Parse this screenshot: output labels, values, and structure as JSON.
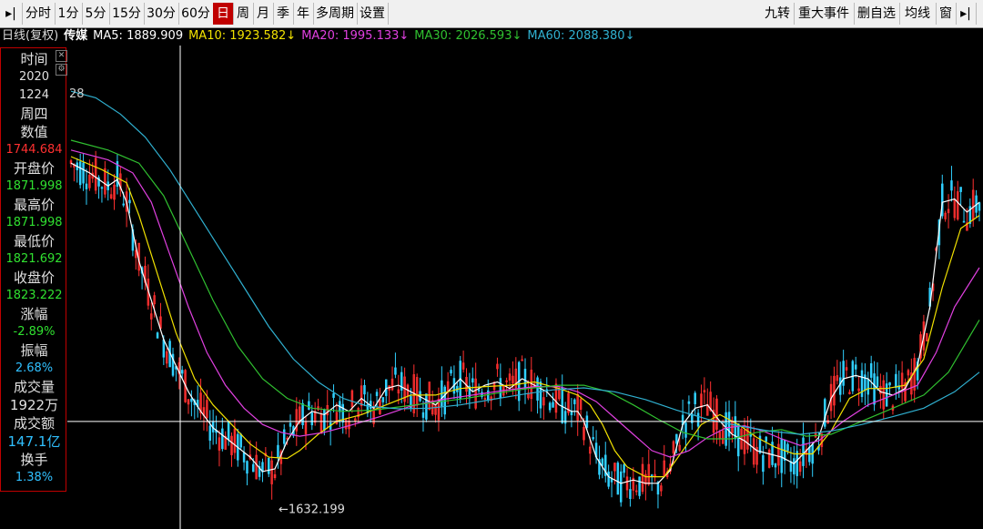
{
  "toolbar": {
    "left_buttons": [
      {
        "label": "▸|",
        "active": false
      },
      {
        "label": "分时",
        "active": false
      },
      {
        "label": "1分",
        "active": false
      },
      {
        "label": "5分",
        "active": false
      },
      {
        "label": "15分",
        "active": false
      },
      {
        "label": "30分",
        "active": false
      },
      {
        "label": "60分",
        "active": false
      },
      {
        "label": "日",
        "active": true
      },
      {
        "label": "周",
        "active": false
      },
      {
        "label": "月",
        "active": false
      },
      {
        "label": "季",
        "active": false
      },
      {
        "label": "年",
        "active": false
      },
      {
        "label": "多周期",
        "active": false
      },
      {
        "label": "设置",
        "active": false
      }
    ],
    "right_buttons": [
      {
        "label": "九转"
      },
      {
        "label": "重大事件"
      },
      {
        "label": "删自选"
      },
      {
        "label": "均线"
      },
      {
        "label": "窗"
      },
      {
        "label": "▸|"
      }
    ]
  },
  "legend": {
    "prefix": "日线(复权)",
    "name": "传媒",
    "items": [
      {
        "label": "MA5: 1889.909",
        "color": "#ffffff"
      },
      {
        "label": "MA10: 1923.582↓",
        "color": "#f0e000"
      },
      {
        "label": "MA20: 1995.133↓",
        "color": "#e040e0"
      },
      {
        "label": "MA30: 2026.593↓",
        "color": "#30c030"
      },
      {
        "label": "MA60: 2088.380↓",
        "color": "#30b0d0"
      }
    ]
  },
  "info_panel": [
    {
      "text": "时间",
      "color": "#e0e0e0",
      "small": false
    },
    {
      "text": "2020",
      "color": "#e0e0e0",
      "small": true
    },
    {
      "text": "1224",
      "color": "#e0e0e0",
      "small": true
    },
    {
      "text": "周四",
      "color": "#e0e0e0",
      "small": false
    },
    {
      "text": "数值",
      "color": "#e0e0e0",
      "small": false
    },
    {
      "text": "1744.684",
      "color": "#ff3030",
      "small": true
    },
    {
      "text": "开盘价",
      "color": "#e0e0e0",
      "small": false
    },
    {
      "text": "1871.998",
      "color": "#30e030",
      "small": true
    },
    {
      "text": "最高价",
      "color": "#e0e0e0",
      "small": false
    },
    {
      "text": "1871.998",
      "color": "#30e030",
      "small": true
    },
    {
      "text": "最低价",
      "color": "#e0e0e0",
      "small": false
    },
    {
      "text": "1821.692",
      "color": "#30e030",
      "small": true
    },
    {
      "text": "收盘价",
      "color": "#e0e0e0",
      "small": false
    },
    {
      "text": "1823.222",
      "color": "#30e030",
      "small": true
    },
    {
      "text": "涨幅",
      "color": "#e0e0e0",
      "small": false
    },
    {
      "text": "-2.89%",
      "color": "#30e030",
      "small": true
    },
    {
      "text": "振幅",
      "color": "#e0e0e0",
      "small": false
    },
    {
      "text": "2.68%",
      "color": "#30c0ff",
      "small": true
    },
    {
      "text": "成交量",
      "color": "#e0e0e0",
      "small": false
    },
    {
      "text": "1922万",
      "color": "#e0e0e0",
      "small": false
    },
    {
      "text": "成交额",
      "color": "#e0e0e0",
      "small": false
    },
    {
      "text": "147.1亿",
      "color": "#30c0ff",
      "small": false
    },
    {
      "text": "换手",
      "color": "#e0e0e0",
      "small": false
    },
    {
      "text": "1.38%",
      "color": "#30c0ff",
      "small": true
    }
  ],
  "chart_data": {
    "type": "line",
    "ylim": [
      1580,
      2320
    ],
    "num_bars": 220,
    "labels": {
      "ma60_start": "28",
      "min_marker": "←1632.199",
      "crosshair_value": "1744.684"
    },
    "min_point": {
      "value": 1632.199
    },
    "series": [
      {
        "name": "MA5",
        "color": "#ffffff",
        "width": 1.2,
        "points": [
          [
            0,
            2140
          ],
          [
            6,
            2125
          ],
          [
            12,
            2105
          ],
          [
            15,
            2115
          ],
          [
            18,
            2080
          ],
          [
            22,
            1990
          ],
          [
            26,
            1930
          ],
          [
            30,
            1870
          ],
          [
            34,
            1830
          ],
          [
            38,
            1790
          ],
          [
            42,
            1760
          ],
          [
            46,
            1735
          ],
          [
            50,
            1720
          ],
          [
            54,
            1705
          ],
          [
            58,
            1690
          ],
          [
            62,
            1668
          ],
          [
            66,
            1672
          ],
          [
            70,
            1715
          ],
          [
            74,
            1745
          ],
          [
            78,
            1760
          ],
          [
            82,
            1755
          ],
          [
            86,
            1770
          ],
          [
            90,
            1760
          ],
          [
            94,
            1780
          ],
          [
            98,
            1765
          ],
          [
            102,
            1795
          ],
          [
            106,
            1800
          ],
          [
            110,
            1790
          ],
          [
            114,
            1780
          ],
          [
            118,
            1770
          ],
          [
            122,
            1790
          ],
          [
            126,
            1810
          ],
          [
            130,
            1790
          ],
          [
            134,
            1800
          ],
          [
            138,
            1805
          ],
          [
            142,
            1795
          ],
          [
            146,
            1810
          ],
          [
            150,
            1800
          ],
          [
            154,
            1790
          ],
          [
            158,
            1770
          ],
          [
            162,
            1760
          ],
          [
            164,
            1760
          ],
          [
            166,
            1745
          ],
          [
            170,
            1690
          ],
          [
            174,
            1660
          ],
          [
            178,
            1650
          ],
          [
            182,
            1655
          ],
          [
            186,
            1650
          ],
          [
            190,
            1650
          ],
          [
            194,
            1670
          ],
          [
            198,
            1740
          ],
          [
            202,
            1765
          ],
          [
            206,
            1770
          ],
          [
            210,
            1745
          ],
          [
            214,
            1725
          ],
          [
            218,
            1715
          ],
          [
            222,
            1700
          ],
          [
            226,
            1695
          ],
          [
            230,
            1690
          ],
          [
            234,
            1680
          ],
          [
            238,
            1700
          ],
          [
            242,
            1720
          ],
          [
            246,
            1780
          ],
          [
            250,
            1810
          ],
          [
            254,
            1815
          ],
          [
            258,
            1810
          ],
          [
            262,
            1790
          ],
          [
            266,
            1785
          ],
          [
            270,
            1795
          ],
          [
            274,
            1830
          ],
          [
            278,
            1920
          ],
          [
            282,
            2080
          ],
          [
            286,
            2085
          ],
          [
            290,
            2065
          ],
          [
            294,
            2080
          ]
        ]
      },
      {
        "name": "MA10",
        "color": "#f0e000",
        "width": 1.2,
        "points": [
          [
            0,
            2150
          ],
          [
            10,
            2130
          ],
          [
            18,
            2110
          ],
          [
            22,
            2060
          ],
          [
            28,
            1970
          ],
          [
            34,
            1880
          ],
          [
            40,
            1810
          ],
          [
            46,
            1770
          ],
          [
            52,
            1740
          ],
          [
            58,
            1710
          ],
          [
            64,
            1690
          ],
          [
            70,
            1688
          ],
          [
            74,
            1700
          ],
          [
            80,
            1725
          ],
          [
            86,
            1745
          ],
          [
            94,
            1755
          ],
          [
            102,
            1770
          ],
          [
            110,
            1785
          ],
          [
            118,
            1785
          ],
          [
            126,
            1795
          ],
          [
            134,
            1798
          ],
          [
            142,
            1800
          ],
          [
            150,
            1805
          ],
          [
            158,
            1795
          ],
          [
            164,
            1785
          ],
          [
            168,
            1770
          ],
          [
            172,
            1740
          ],
          [
            176,
            1700
          ],
          [
            180,
            1675
          ],
          [
            186,
            1660
          ],
          [
            192,
            1660
          ],
          [
            198,
            1700
          ],
          [
            204,
            1740
          ],
          [
            210,
            1755
          ],
          [
            216,
            1740
          ],
          [
            222,
            1720
          ],
          [
            228,
            1705
          ],
          [
            234,
            1695
          ],
          [
            240,
            1695
          ],
          [
            246,
            1730
          ],
          [
            252,
            1780
          ],
          [
            258,
            1795
          ],
          [
            264,
            1795
          ],
          [
            270,
            1800
          ],
          [
            276,
            1840
          ],
          [
            282,
            1950
          ],
          [
            288,
            2040
          ],
          [
            294,
            2060
          ]
        ]
      },
      {
        "name": "MA20",
        "color": "#e040e0",
        "width": 1.2,
        "points": [
          [
            0,
            2160
          ],
          [
            12,
            2145
          ],
          [
            20,
            2125
          ],
          [
            26,
            2080
          ],
          [
            32,
            2000
          ],
          [
            38,
            1920
          ],
          [
            44,
            1850
          ],
          [
            50,
            1800
          ],
          [
            56,
            1765
          ],
          [
            62,
            1740
          ],
          [
            68,
            1728
          ],
          [
            74,
            1722
          ],
          [
            82,
            1728
          ],
          [
            90,
            1738
          ],
          [
            100,
            1752
          ],
          [
            110,
            1768
          ],
          [
            120,
            1778
          ],
          [
            130,
            1785
          ],
          [
            140,
            1792
          ],
          [
            150,
            1798
          ],
          [
            158,
            1798
          ],
          [
            164,
            1790
          ],
          [
            170,
            1775
          ],
          [
            176,
            1750
          ],
          [
            182,
            1725
          ],
          [
            188,
            1700
          ],
          [
            194,
            1690
          ],
          [
            200,
            1700
          ],
          [
            206,
            1720
          ],
          [
            212,
            1735
          ],
          [
            218,
            1738
          ],
          [
            224,
            1730
          ],
          [
            230,
            1718
          ],
          [
            236,
            1708
          ],
          [
            242,
            1715
          ],
          [
            250,
            1745
          ],
          [
            258,
            1770
          ],
          [
            266,
            1785
          ],
          [
            274,
            1800
          ],
          [
            280,
            1850
          ],
          [
            286,
            1920
          ],
          [
            294,
            1980
          ]
        ]
      },
      {
        "name": "MA30",
        "color": "#30c030",
        "width": 1.2,
        "points": [
          [
            0,
            2175
          ],
          [
            12,
            2160
          ],
          [
            22,
            2140
          ],
          [
            30,
            2090
          ],
          [
            38,
            2010
          ],
          [
            46,
            1930
          ],
          [
            54,
            1860
          ],
          [
            62,
            1810
          ],
          [
            70,
            1780
          ],
          [
            78,
            1765
          ],
          [
            88,
            1760
          ],
          [
            98,
            1762
          ],
          [
            108,
            1768
          ],
          [
            118,
            1774
          ],
          [
            128,
            1780
          ],
          [
            138,
            1788
          ],
          [
            148,
            1795
          ],
          [
            158,
            1800
          ],
          [
            166,
            1800
          ],
          [
            174,
            1790
          ],
          [
            182,
            1770
          ],
          [
            190,
            1748
          ],
          [
            198,
            1728
          ],
          [
            206,
            1718
          ],
          [
            214,
            1718
          ],
          [
            222,
            1728
          ],
          [
            230,
            1732
          ],
          [
            238,
            1722
          ],
          [
            246,
            1725
          ],
          [
            256,
            1745
          ],
          [
            266,
            1765
          ],
          [
            276,
            1785
          ],
          [
            284,
            1820
          ],
          [
            294,
            1900
          ]
        ]
      },
      {
        "name": "MA60",
        "color": "#30b0d0",
        "width": 1.2,
        "points": [
          [
            0,
            2250
          ],
          [
            8,
            2240
          ],
          [
            16,
            2215
          ],
          [
            24,
            2180
          ],
          [
            32,
            2130
          ],
          [
            40,
            2070
          ],
          [
            48,
            2010
          ],
          [
            56,
            1950
          ],
          [
            64,
            1890
          ],
          [
            72,
            1840
          ],
          [
            80,
            1805
          ],
          [
            88,
            1780
          ],
          [
            96,
            1768
          ],
          [
            106,
            1764
          ],
          [
            116,
            1765
          ],
          [
            126,
            1770
          ],
          [
            136,
            1778
          ],
          [
            146,
            1786
          ],
          [
            156,
            1793
          ],
          [
            166,
            1796
          ],
          [
            176,
            1790
          ],
          [
            186,
            1778
          ],
          [
            196,
            1762
          ],
          [
            206,
            1748
          ],
          [
            216,
            1738
          ],
          [
            226,
            1730
          ],
          [
            236,
            1725
          ],
          [
            246,
            1730
          ],
          [
            256,
            1740
          ],
          [
            266,
            1752
          ],
          [
            276,
            1765
          ],
          [
            286,
            1790
          ],
          [
            294,
            1820
          ]
        ]
      }
    ]
  }
}
